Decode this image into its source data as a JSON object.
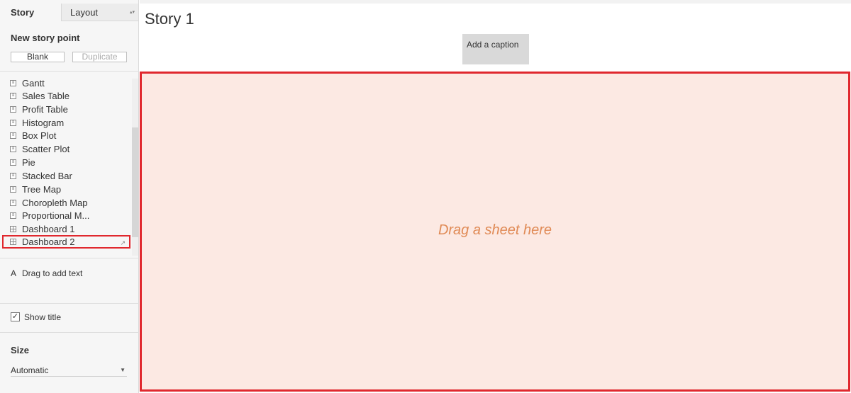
{
  "tabs": {
    "story": "Story",
    "layout": "Layout"
  },
  "new_story_point": {
    "title": "New story point",
    "blank": "Blank",
    "duplicate": "Duplicate"
  },
  "sheets": [
    {
      "label": "Gantt",
      "type": "sheet"
    },
    {
      "label": "Sales Table",
      "type": "sheet"
    },
    {
      "label": "Profit Table",
      "type": "sheet"
    },
    {
      "label": "Histogram",
      "type": "sheet"
    },
    {
      "label": "Box Plot",
      "type": "sheet"
    },
    {
      "label": "Scatter Plot",
      "type": "sheet"
    },
    {
      "label": "Pie",
      "type": "sheet"
    },
    {
      "label": "Stacked Bar",
      "type": "sheet"
    },
    {
      "label": "Tree Map",
      "type": "sheet"
    },
    {
      "label": "Choropleth Map",
      "type": "sheet"
    },
    {
      "label": "Proportional M...",
      "type": "sheet"
    },
    {
      "label": "Dashboard 1",
      "type": "dashboard"
    },
    {
      "label": "Dashboard 2",
      "type": "dashboard",
      "selected": true
    }
  ],
  "drag_text": {
    "icon": "A",
    "label": "Drag to add text"
  },
  "show_title": {
    "label": "Show title",
    "checked": true
  },
  "size": {
    "title": "Size",
    "value": "Automatic"
  },
  "story": {
    "title": "Story 1",
    "caption": "Add a caption",
    "drop_text": "Drag a sheet here"
  },
  "colors": {
    "accent": "#e0282e",
    "drop_bg": "#fce9e3",
    "drop_text": "#e08a55"
  }
}
